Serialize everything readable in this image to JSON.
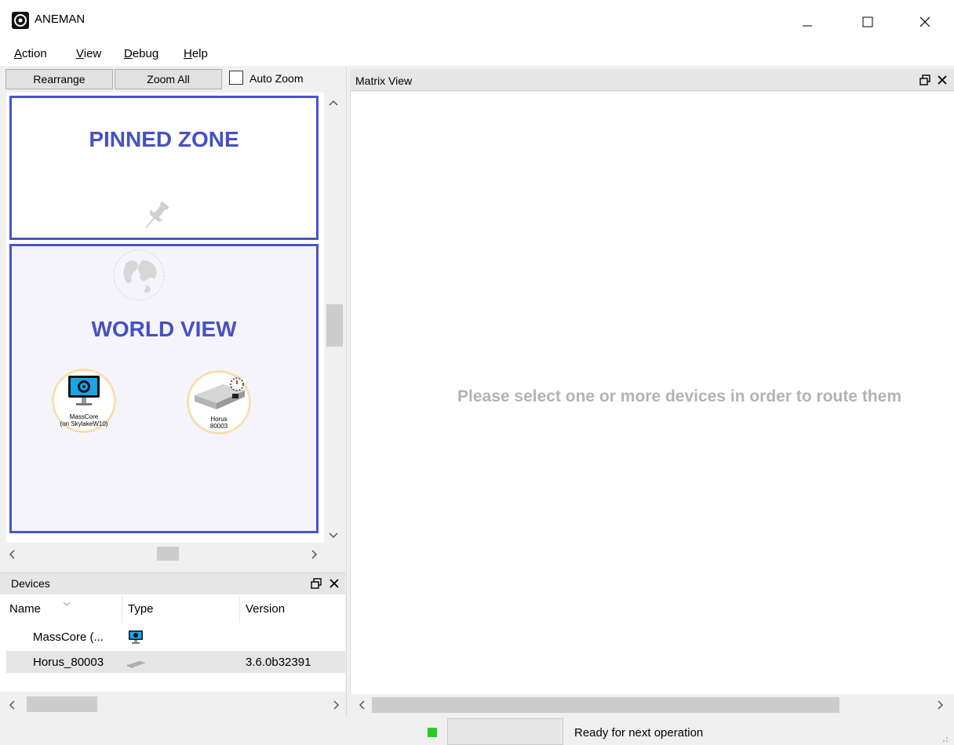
{
  "window": {
    "title": "ANEMAN"
  },
  "menu": [
    {
      "underlined": "A",
      "rest": "ction"
    },
    {
      "underlined": "V",
      "rest": "iew"
    },
    {
      "underlined": "D",
      "rest": "ebug"
    },
    {
      "underlined": "H",
      "rest": "elp"
    }
  ],
  "toolbar": {
    "rearrange": "Rearrange",
    "zoom_all": "Zoom All",
    "auto_zoom": "Auto Zoom",
    "auto_zoom_checked": false
  },
  "canvas": {
    "pinned_zone_title": "PINNED ZONE",
    "world_view_title": "WORLD VIEW",
    "devices": [
      {
        "line1": "MassCore",
        "line2": "(on SkylakeW10)",
        "icon": "computer-icon"
      },
      {
        "line1": "Horus",
        "line2": "80003",
        "icon": "rack-device-icon"
      }
    ]
  },
  "devices_panel": {
    "title": "Devices",
    "columns": [
      "Name",
      "Type",
      "Version"
    ],
    "rows": [
      {
        "name": "MassCore (...",
        "type_icon": "computer-icon",
        "version": ""
      },
      {
        "name": "Horus_80003",
        "type_icon": "rack-device-icon",
        "version": "3.6.0b32391"
      }
    ]
  },
  "matrix": {
    "title": "Matrix View",
    "message": "Please select one or more devices in order to route them"
  },
  "status": {
    "text": "Ready for next operation",
    "led_color": "#22d022"
  }
}
